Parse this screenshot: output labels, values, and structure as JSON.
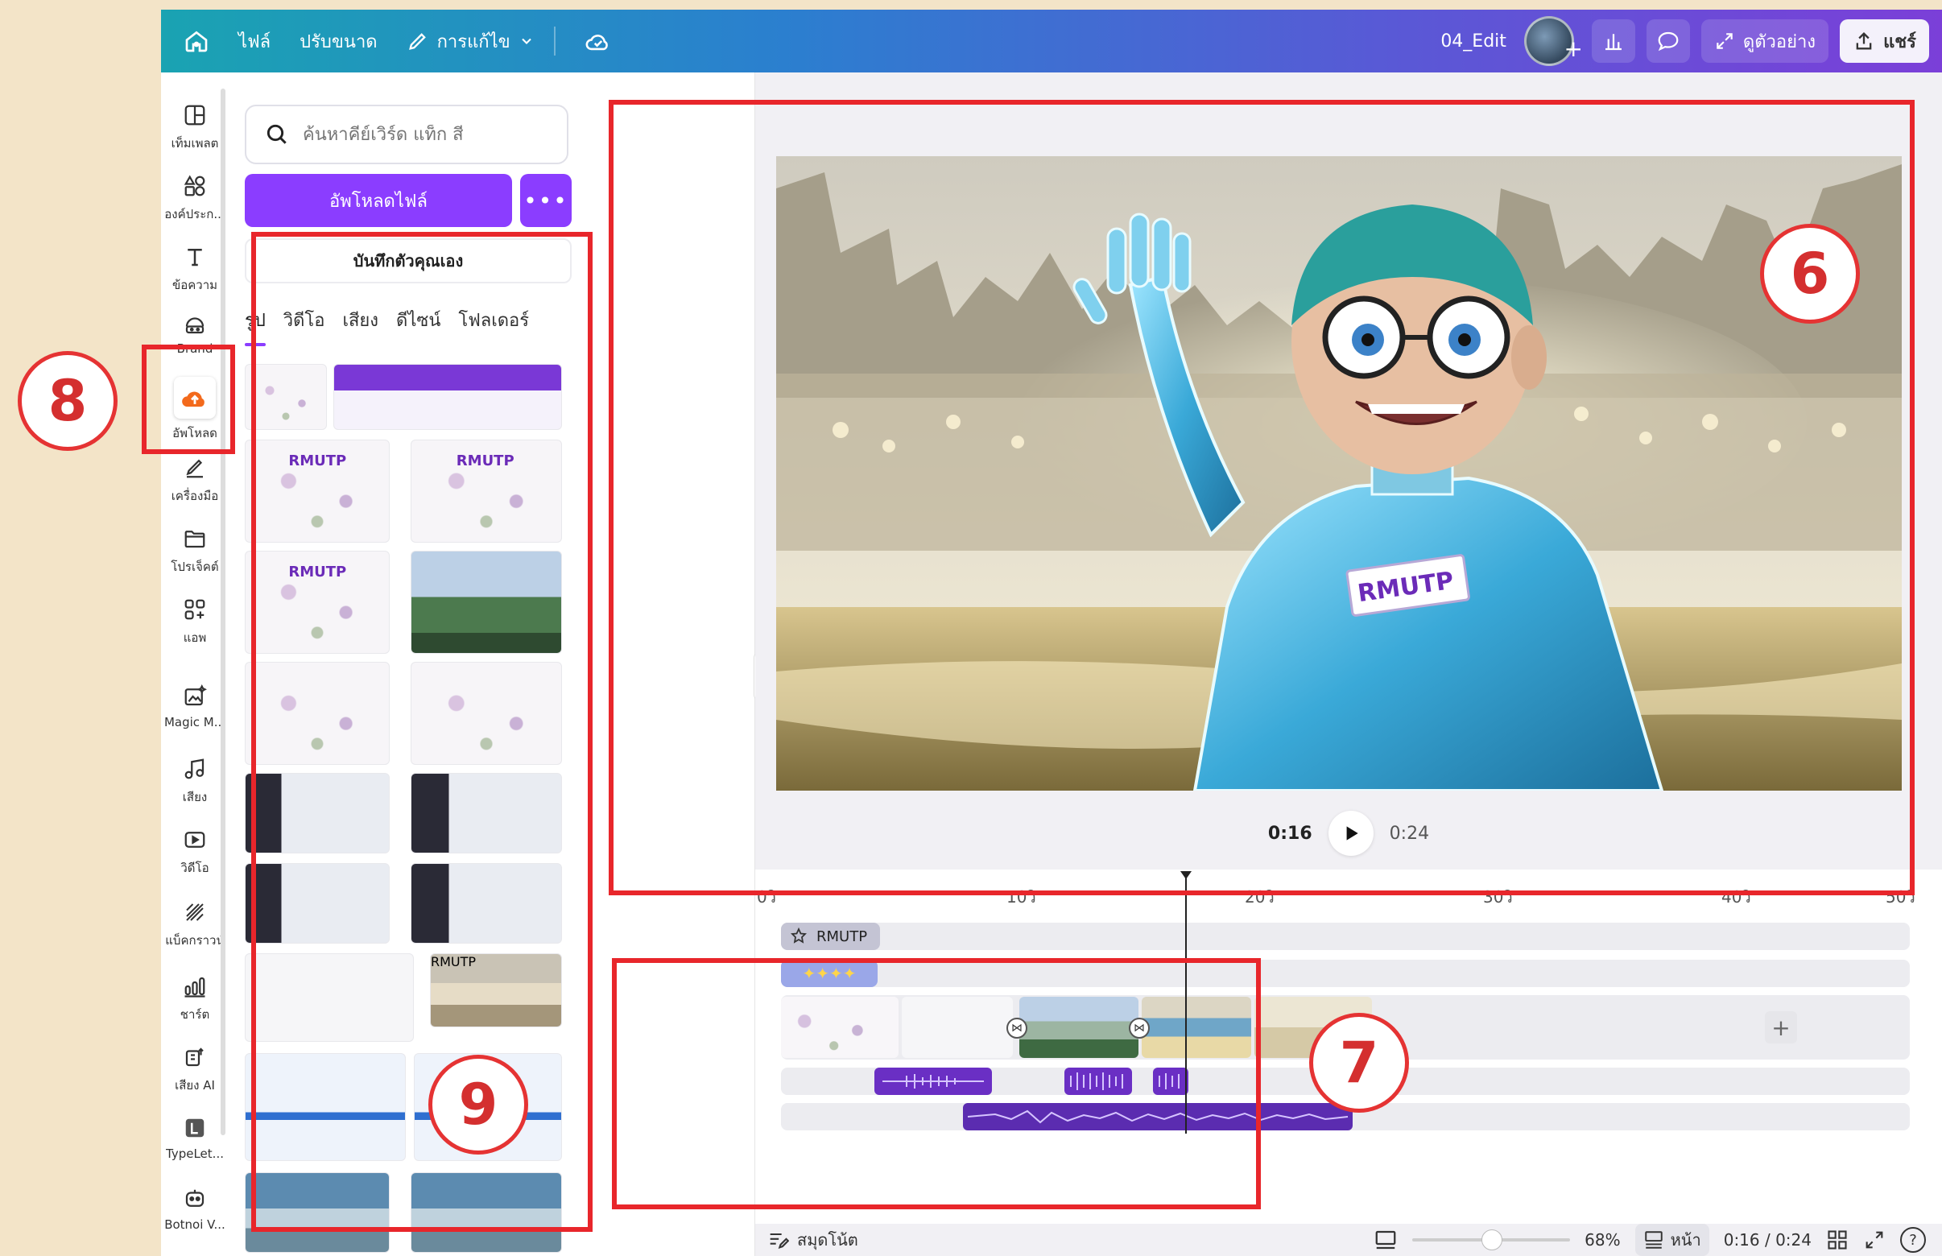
{
  "topbar": {
    "file_label": "ไฟล์",
    "resize_label": "ปรับขนาด",
    "edit_label": "การแก้ไข",
    "doc_title": "04_Edit",
    "preview_label": "ดูตัวอย่าง",
    "share_label": "แชร์"
  },
  "rail": {
    "items": [
      {
        "label": "เท็มเพลต",
        "icon": "template-icon"
      },
      {
        "label": "องค์ประก...",
        "icon": "elements-icon"
      },
      {
        "label": "ข้อความ",
        "icon": "text-icon"
      },
      {
        "label": "Brand",
        "icon": "brand-icon"
      },
      {
        "label": "อัพโหลด",
        "icon": "upload-cloud-icon"
      },
      {
        "label": "เครื่องมือ",
        "icon": "draw-icon"
      },
      {
        "label": "โปรเจ็คต์",
        "icon": "folder-icon"
      },
      {
        "label": "แอพ",
        "icon": "apps-icon"
      },
      {
        "label": "Magic M...",
        "icon": "magic-media-icon"
      },
      {
        "label": "เสียง",
        "icon": "music-icon"
      },
      {
        "label": "วิดีโอ",
        "icon": "video-icon"
      },
      {
        "label": "แบ็คกราวน์",
        "icon": "background-icon"
      },
      {
        "label": "ชาร์ต",
        "icon": "chart-icon"
      },
      {
        "label": "เสียง AI",
        "icon": "ai-voice-icon"
      },
      {
        "label": "TypeLet...",
        "icon": "typelet-icon"
      },
      {
        "label": "Botnoi V...",
        "icon": "botnoi-icon"
      }
    ]
  },
  "panel": {
    "search_placeholder": "ค้นหาคีย์เวิร์ด แท็ก สี",
    "upload_button": "อัพโหลดไฟล์",
    "more_button": "•••",
    "record_button": "บันทึกตัวคุณเอง",
    "tabs": [
      "รูป",
      "วิดีโอ",
      "เสียง",
      "ดีไซน์",
      "โฟลเดอร์"
    ],
    "thumb_brand": "RMUTP"
  },
  "canvas": {
    "badge_text": "RMUTP"
  },
  "player": {
    "current_time": "0:16",
    "total_time": "0:24"
  },
  "timeline": {
    "ruler": [
      "0วิ",
      "10วิ",
      "20วิ",
      "30วิ",
      "40วิ",
      "50วิ"
    ],
    "text_track_label": "RMUTP",
    "sparkles": "✦✦✦✦",
    "add_clip": "+",
    "playhead_fraction": 0.667
  },
  "bottombar": {
    "notes_label": "สมุดโน้ต",
    "zoom": "68%",
    "page_label": "หน้า",
    "time_readout": "0:16 / 0:24",
    "help": "?"
  },
  "callouts": {
    "canvas": "6",
    "timeline": "7",
    "upload_rail": "8",
    "uploads_panel": "9"
  },
  "colors": {
    "accent": "#8b3dff",
    "callout_red": "#e8262b",
    "page_bg": "#f3e4c8"
  }
}
